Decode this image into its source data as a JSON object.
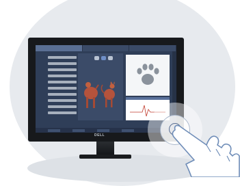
{
  "monitor": {
    "brand": "DELL",
    "tabs": [
      "",
      "",
      ""
    ],
    "bottom_buttons": [
      "",
      "",
      "",
      ""
    ]
  },
  "colors": {
    "screen_bg": "#2f3e58",
    "accent": "#5a6f93",
    "animal_red": "#b5533c",
    "ecg_line": "#c0392b"
  },
  "icons": [
    "cat-icon",
    "dog-icon",
    "paw-print-icon",
    "hand-pointer-icon"
  ]
}
